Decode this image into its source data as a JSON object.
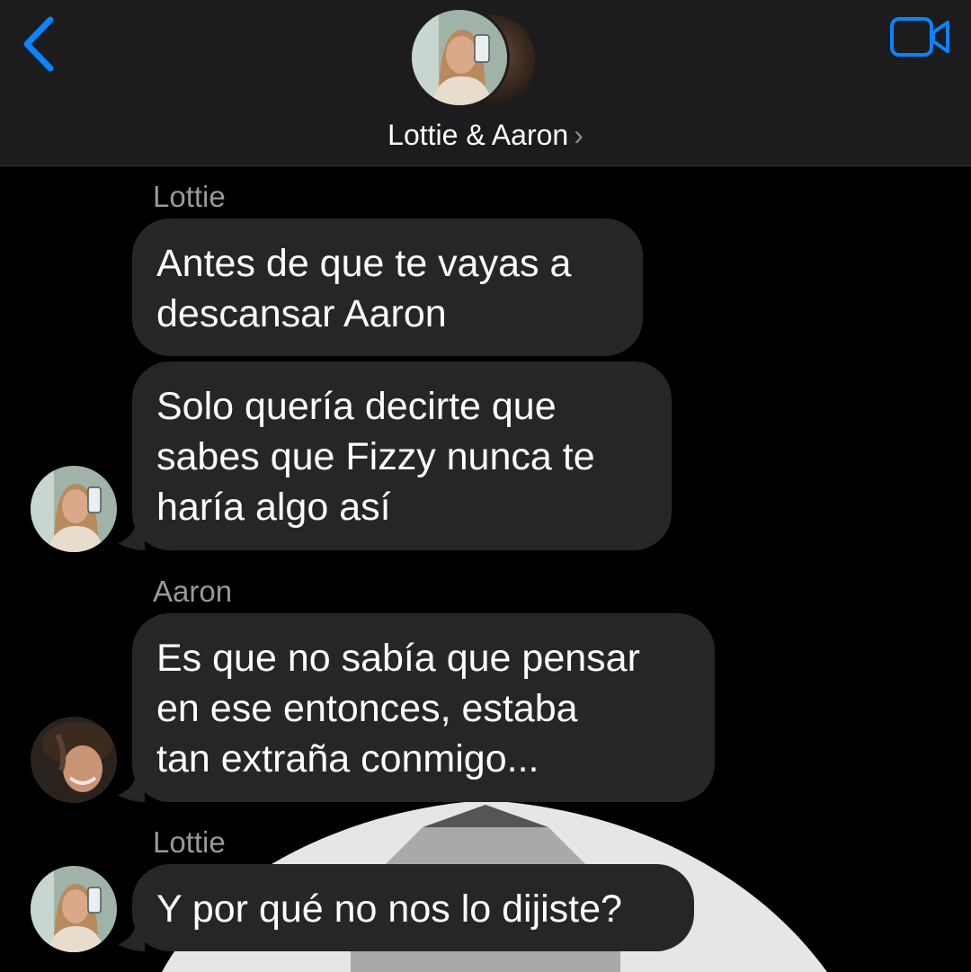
{
  "header": {
    "title": "Lottie & Aaron",
    "chevron": "›",
    "back_icon": "chevron-left-icon",
    "video_icon": "video-camera-icon",
    "accent_color": "#0a84ff"
  },
  "messages": [
    {
      "sender": "Lottie",
      "text": "Antes de que te vayas a\ndescansar Aaron",
      "show_avatar": false
    },
    {
      "sender": "",
      "text": "Solo quería decirte que\nsabes que Fizzy nunca te\nharía algo así",
      "show_avatar": true,
      "avatar": "lottie"
    },
    {
      "sender": "Aaron",
      "text": "Es que no sabía que pensar\nen ese entonces, estaba\ntan extraña conmigo...",
      "show_avatar": true,
      "avatar": "aaron"
    },
    {
      "sender": "Lottie",
      "text": "Y por qué no nos lo dijiste?",
      "show_avatar": true,
      "avatar": "lottie"
    }
  ]
}
